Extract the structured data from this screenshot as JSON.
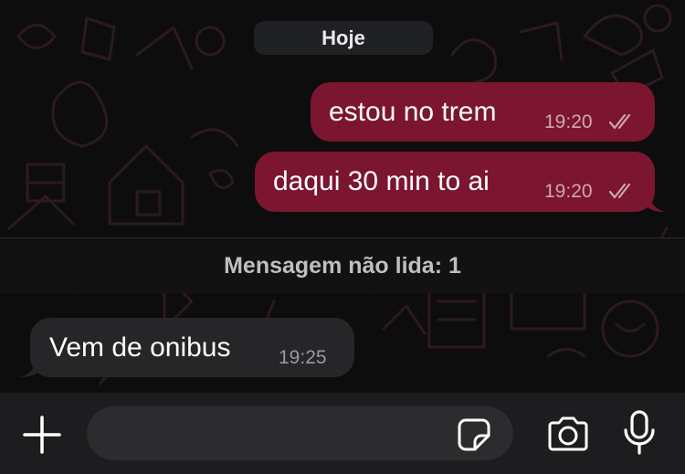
{
  "date_separator": "Hoje",
  "messages": [
    {
      "direction": "outgoing",
      "text": "estou no trem",
      "time": "19:20",
      "status": "read-ticks"
    },
    {
      "direction": "outgoing",
      "text": "daqui 30 min to ai",
      "time": "19:20",
      "status": "read-ticks"
    },
    {
      "direction": "incoming",
      "text": "Vem de onibus",
      "time": "19:25"
    }
  ],
  "unread_banner": "Mensagem não lida: 1",
  "input": {
    "value": "",
    "placeholder": ""
  },
  "icons": {
    "attach": "plus-icon",
    "sticker": "sticker-icon",
    "camera": "camera-icon",
    "mic": "microphone-icon",
    "read_status": "double-check-icon"
  },
  "colors": {
    "outgoing_bubble": "#7b1530",
    "incoming_bubble": "#262628",
    "background": "#0e0d0e",
    "input_bar": "#1d1d1f"
  }
}
